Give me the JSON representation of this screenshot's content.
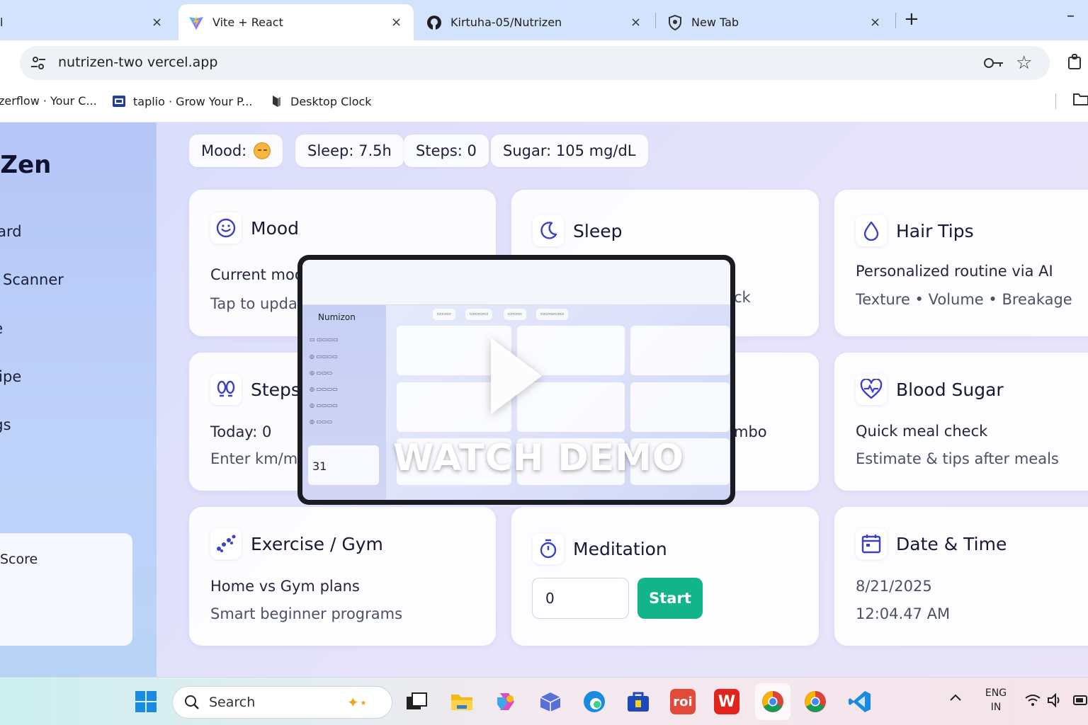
{
  "browser": {
    "tabs": [
      {
        "title": "l",
        "active": false
      },
      {
        "title": "Vite + React",
        "active": true
      },
      {
        "title": "Kirtuha-05/Nutrizen",
        "active": false
      },
      {
        "title": "New Tab",
        "active": false
      }
    ],
    "new_tab": "+",
    "minimize": "–",
    "close": "×",
    "url": "nutrizen-two vercel.app",
    "bookmarks": [
      {
        "label": "zerflow · Your C..."
      },
      {
        "label": "taplio · Grow Your P..."
      },
      {
        "label": "Desktop Clock"
      }
    ]
  },
  "app": {
    "brand": "riZen",
    "nav": [
      "board",
      "Scanner",
      "ne",
      "kipe",
      "ngs"
    ],
    "score_label": "Score",
    "chips": {
      "mood": "Mood:",
      "sleep": "Sleep: 7.5h",
      "steps": "Steps: 0",
      "sugar": "Sugar: 105 mg/dL"
    },
    "cards": {
      "mood": {
        "title": "Mood",
        "l1": "Current moo",
        "l2": "Tap to updat"
      },
      "sleep": {
        "title": "Sleep",
        "tail": "ck"
      },
      "hair": {
        "title": "Hair Tips",
        "l1": "Personalized routine via AI",
        "l2": "Texture • Volume • Breakage"
      },
      "steps": {
        "title": "Steps",
        "l1": "Today: 0",
        "l2": "Enter km/m"
      },
      "combo": {
        "tail": "mbo"
      },
      "sugar": {
        "title": "Blood Sugar",
        "l1": "Quick meal check",
        "l2": "Estimate & tips after meals"
      },
      "exercise": {
        "title": "Exercise / Gym",
        "l1": "Home vs Gym plans",
        "l2": "Smart beginner programs"
      },
      "meditation": {
        "title": "Meditation",
        "input_value": "0",
        "button": "Start"
      },
      "datetime": {
        "title": "Date & Time",
        "date": "8/21/2025",
        "time": "12:04.47 AM"
      }
    },
    "demo": {
      "label": "WATCH DEMO",
      "mini_brand": "Numizon",
      "mini_date": "31"
    }
  },
  "taskbar": {
    "search": "Search",
    "lang": "ENG",
    "region": "IN"
  },
  "colors": {
    "accent": "#3b3fc9",
    "start_button": "#12b48a",
    "tab_bar": "#d3e3fd"
  }
}
